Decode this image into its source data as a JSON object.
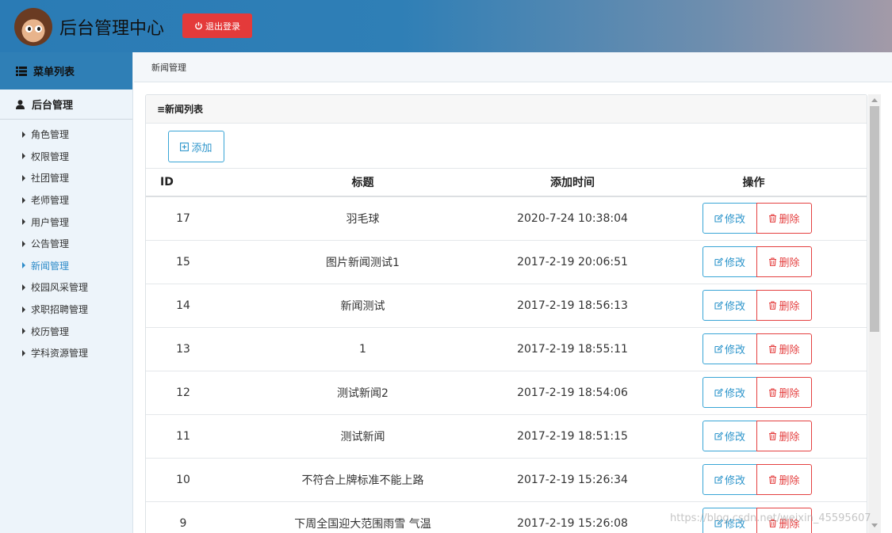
{
  "header": {
    "title": "后台管理中心",
    "logout_label": "退出登录"
  },
  "sidebar": {
    "menu_header": "菜单列表",
    "group_title": "后台管理",
    "items": [
      {
        "label": "角色管理",
        "active": false
      },
      {
        "label": "权限管理",
        "active": false
      },
      {
        "label": "社团管理",
        "active": false
      },
      {
        "label": "老师管理",
        "active": false
      },
      {
        "label": "用户管理",
        "active": false
      },
      {
        "label": "公告管理",
        "active": false
      },
      {
        "label": "新闻管理",
        "active": true
      },
      {
        "label": "校园风采管理",
        "active": false
      },
      {
        "label": "求职招聘管理",
        "active": false
      },
      {
        "label": "校历管理",
        "active": false
      },
      {
        "label": "学科资源管理",
        "active": false
      }
    ]
  },
  "breadcrumb": "新闻管理",
  "panel": {
    "title": "≡新闻列表",
    "add_label": "添加"
  },
  "table": {
    "columns": [
      "ID",
      "标题",
      "添加时间",
      "操作"
    ],
    "edit_label": "修改",
    "delete_label": "删除",
    "rows": [
      {
        "id": "17",
        "title": "羽毛球",
        "time": "2020-7-24 10:38:04"
      },
      {
        "id": "15",
        "title": "图片新闻测试1",
        "time": "2017-2-19 20:06:51"
      },
      {
        "id": "14",
        "title": "新闻测试",
        "time": "2017-2-19 18:56:13"
      },
      {
        "id": "13",
        "title": "1",
        "time": "2017-2-19 18:55:11"
      },
      {
        "id": "12",
        "title": "测试新闻2",
        "time": "2017-2-19 18:54:06"
      },
      {
        "id": "11",
        "title": "测试新闻",
        "time": "2017-2-19 18:51:15"
      },
      {
        "id": "10",
        "title": "不符合上牌标准不能上路",
        "time": "2017-2-19 15:26:34"
      },
      {
        "id": "9",
        "title": "下周全国迎大范围雨雪 气温",
        "time": "2017-2-19 15:26:08"
      }
    ]
  },
  "watermark": "https://blog.csdn.net/weixin_45595607",
  "colors": {
    "header_blue": "#2f7fb6",
    "logout_red": "#e43a3a",
    "edit_blue": "#2d95cb",
    "delete_red": "#e44040",
    "active_link": "#2d8bc9"
  }
}
